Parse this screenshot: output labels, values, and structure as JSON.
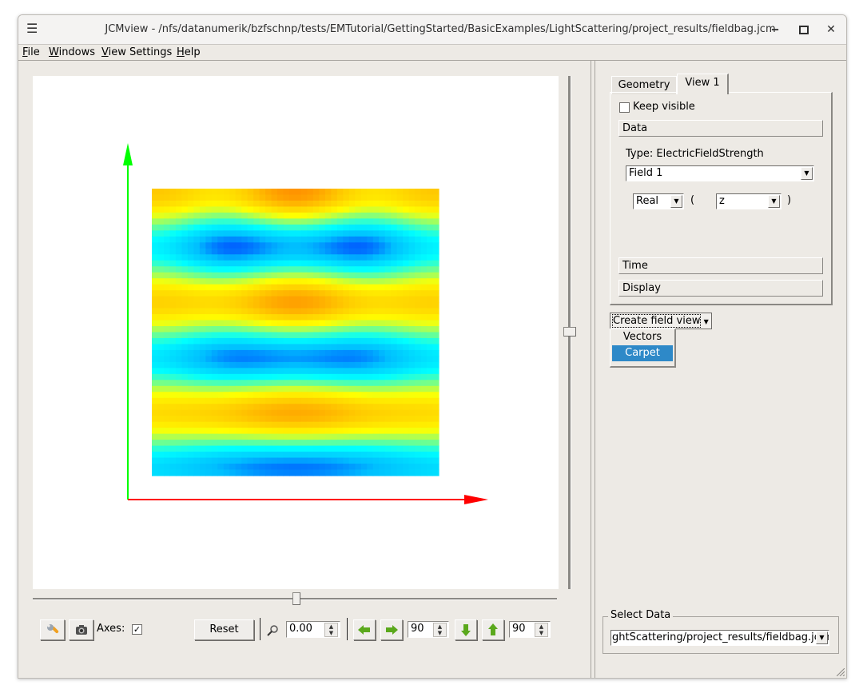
{
  "window": {
    "title": "JCMview - /nfs/datanumerik/bzfschnp/tests/EMTutorial/GettingStarted/BasicExamples/LightScattering/project_results/fieldbag.jcm",
    "icons": {
      "menu": "hamburger-icon",
      "minimize": "minimize-icon",
      "maximize": "maximize-icon",
      "close": "close-icon"
    }
  },
  "menubar": {
    "items": [
      {
        "label": "File",
        "mnemonic": "F",
        "rest": "ile"
      },
      {
        "label": "Windows",
        "mnemonic": "W",
        "rest": "indows"
      },
      {
        "label": "View Settings",
        "mnemonic": "V",
        "rest": "iew Settings"
      },
      {
        "label": "Help",
        "mnemonic": "H",
        "rest": "elp"
      }
    ]
  },
  "viewer": {
    "axes": {
      "y_axis_color": "#00ff00",
      "x_axis_color": "#ff0000"
    },
    "field_plot": {
      "colormap": [
        "#0000ff",
        "#00bfff",
        "#00ffff",
        "#7fff7f",
        "#ffff00",
        "#ffcc00",
        "#ff8c00"
      ],
      "description": "Real part of z component of electric field strength, carpet view"
    },
    "vertical_slider_value": 0.5,
    "horizontal_slider_value": 0.5
  },
  "toolbar": {
    "settings_icon": "wrench-icon",
    "snapshot_icon": "camera-icon",
    "axes_label": "Axes:",
    "axes_checked": true,
    "reset_label": "Reset",
    "zoom_icon": "magnifier-icon",
    "zoom_value": "0.00",
    "rotate_left_icon": "arrow-left-icon",
    "rotate_right_icon": "arrow-right-icon",
    "horizontal_angle": "90",
    "rotate_down_icon": "arrow-down-icon",
    "rotate_up_icon": "arrow-up-icon",
    "vertical_angle": "90"
  },
  "panel": {
    "tabs": [
      {
        "label": "Geometry",
        "active": false
      },
      {
        "label": "View 1",
        "active": true
      }
    ],
    "keep_visible_label": "Keep visible",
    "keep_visible_checked": false,
    "sections": {
      "data": "Data",
      "time": "Time",
      "display": "Display"
    },
    "type_label": "Type: ElectricFieldStrength",
    "field_select": "Field 1",
    "part_select": "Real",
    "open_paren": "(",
    "component_select": "z",
    "close_paren": ")",
    "create_field_view_label": "Create field view",
    "create_field_view_menu": [
      {
        "label": "Vectors",
        "selected": false
      },
      {
        "label": "Carpet",
        "selected": true
      }
    ],
    "select_data_title": "Select Data",
    "select_data_value": "ghtScattering/project_results/fieldbag.jcm"
  }
}
